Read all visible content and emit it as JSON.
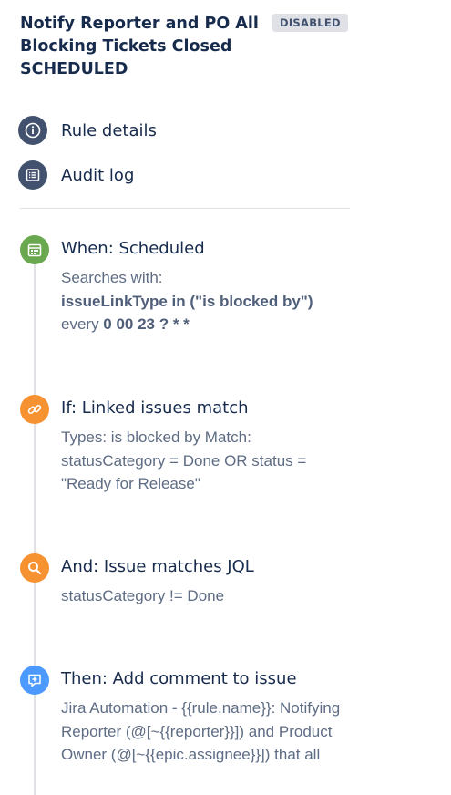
{
  "header": {
    "title": "Notify Reporter and PO All Blocking Tickets Closed SCHEDULED",
    "status_badge": "DISABLED"
  },
  "nav": {
    "rule_details": "Rule details",
    "audit_log": "Audit log"
  },
  "steps": [
    {
      "title": "When: Scheduled",
      "icon": "calendar-icon",
      "color": "#6aa84f",
      "line1": "Searches with:",
      "jql": "issueLinkType in (\"is blocked by\")",
      "every_prefix": "every ",
      "cron": "0 00 23 ? * *"
    },
    {
      "title": "If: Linked issues match",
      "icon": "link-icon",
      "color": "#f79232",
      "description": "Types: is blocked by Match: statusCategory = Done OR status = \"Ready for Release\""
    },
    {
      "title": "And: Issue matches JQL",
      "icon": "search-icon",
      "color": "#f79232",
      "description": "statusCategory != Done"
    },
    {
      "title": "Then: Add comment to issue",
      "icon": "comment-icon",
      "color": "#4c9aff",
      "description": "Jira Automation - {{rule.name}}: Notifying Reporter (@[~{{reporter}}]) and Product Owner (@[~{{epic.assignee}}]) that all"
    }
  ]
}
